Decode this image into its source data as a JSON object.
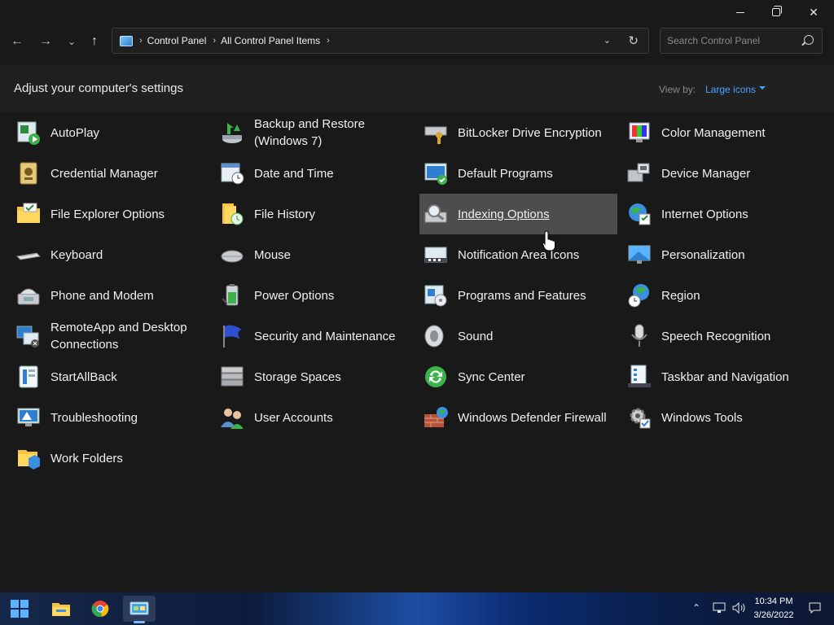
{
  "address": {
    "crumbs": [
      "Control Panel",
      "All Control Panel Items"
    ]
  },
  "search": {
    "placeholder": "Search Control Panel"
  },
  "header": {
    "title": "Adjust your computer's settings",
    "view_by_label": "View by:",
    "view_by_value": "Large icons"
  },
  "items": [
    {
      "label": "AutoPlay",
      "icon": "autoplay-icon"
    },
    {
      "label": "Backup and Restore (Windows 7)",
      "icon": "backup-icon"
    },
    {
      "label": "BitLocker Drive Encryption",
      "icon": "bitlocker-icon"
    },
    {
      "label": "Color Management",
      "icon": "color-management-icon"
    },
    {
      "label": "Credential Manager",
      "icon": "credential-icon"
    },
    {
      "label": "Date and Time",
      "icon": "calendar-clock-icon"
    },
    {
      "label": "Default Programs",
      "icon": "default-programs-icon"
    },
    {
      "label": "Device Manager",
      "icon": "device-manager-icon"
    },
    {
      "label": "File Explorer Options",
      "icon": "folder-options-icon"
    },
    {
      "label": "File History",
      "icon": "file-history-icon"
    },
    {
      "label": "Indexing Options",
      "icon": "indexing-icon"
    },
    {
      "label": "Internet Options",
      "icon": "globe-icon"
    },
    {
      "label": "Keyboard",
      "icon": "keyboard-icon"
    },
    {
      "label": "Mouse",
      "icon": "mouse-icon"
    },
    {
      "label": "Notification Area Icons",
      "icon": "notification-area-icon"
    },
    {
      "label": "Personalization",
      "icon": "personalization-icon"
    },
    {
      "label": "Phone and Modem",
      "icon": "phone-icon"
    },
    {
      "label": "Power Options",
      "icon": "battery-icon"
    },
    {
      "label": "Programs and Features",
      "icon": "programs-icon"
    },
    {
      "label": "Region",
      "icon": "region-icon"
    },
    {
      "label": "RemoteApp and Desktop Connections",
      "icon": "remote-desktop-icon"
    },
    {
      "label": "Security and Maintenance",
      "icon": "flag-icon"
    },
    {
      "label": "Sound",
      "icon": "speaker-icon"
    },
    {
      "label": "Speech Recognition",
      "icon": "microphone-icon"
    },
    {
      "label": "StartAllBack",
      "icon": "startallback-icon"
    },
    {
      "label": "Storage Spaces",
      "icon": "storage-icon"
    },
    {
      "label": "Sync Center",
      "icon": "sync-icon"
    },
    {
      "label": "Taskbar and Navigation",
      "icon": "taskbar-icon"
    },
    {
      "label": "Troubleshooting",
      "icon": "troubleshoot-icon"
    },
    {
      "label": "User Accounts",
      "icon": "users-icon"
    },
    {
      "label": "Windows Defender Firewall",
      "icon": "firewall-icon"
    },
    {
      "label": "Windows Tools",
      "icon": "gear-icon"
    },
    {
      "label": "Work Folders",
      "icon": "work-folders-icon"
    }
  ],
  "hovered_item": "Indexing Options",
  "taskbar": {
    "time": "10:34 PM",
    "date": "3/26/2022"
  }
}
